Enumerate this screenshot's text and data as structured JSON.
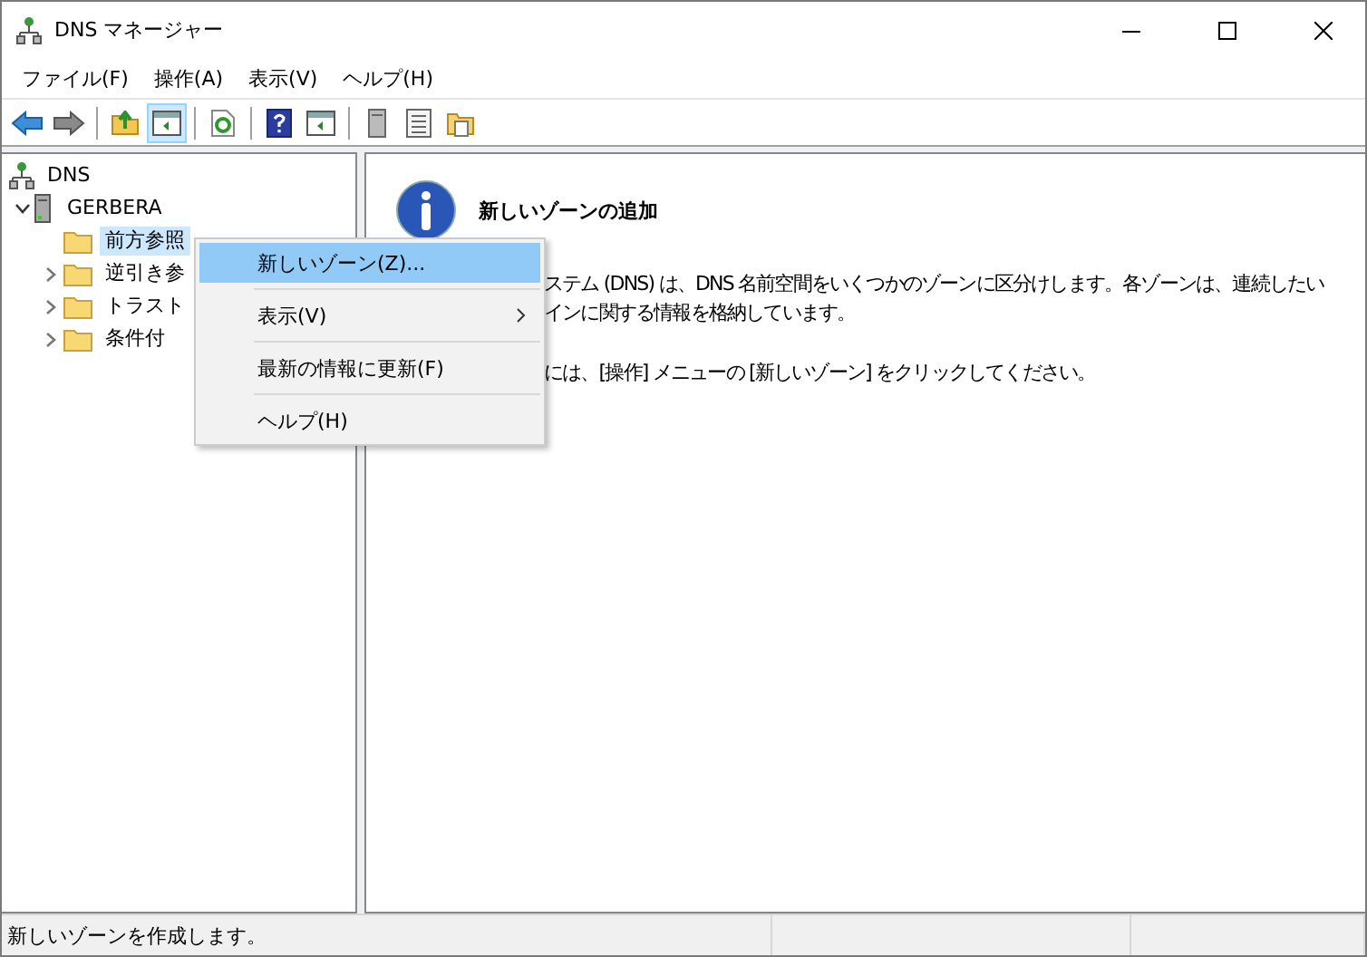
{
  "window": {
    "title": "DNS マネージャー"
  },
  "menu": [
    {
      "label": "ファイル(F)"
    },
    {
      "label": "操作(A)"
    },
    {
      "label": "表示(V)"
    },
    {
      "label": "ヘルプ(H)"
    }
  ],
  "toolbar": [
    {
      "kind": "back",
      "pressed": false
    },
    {
      "kind": "forward",
      "pressed": false
    },
    {
      "kind": "sep"
    },
    {
      "kind": "up",
      "pressed": false
    },
    {
      "kind": "tree",
      "pressed": true
    },
    {
      "kind": "sep"
    },
    {
      "kind": "refresh",
      "pressed": false
    },
    {
      "kind": "sep"
    },
    {
      "kind": "help",
      "pressed": false
    },
    {
      "kind": "pane",
      "pressed": false
    },
    {
      "kind": "sep"
    },
    {
      "kind": "server",
      "pressed": false
    },
    {
      "kind": "list",
      "pressed": false
    },
    {
      "kind": "props",
      "pressed": false
    }
  ],
  "tree": [
    {
      "label": "DNS",
      "kind": "dns",
      "selected": false,
      "children": [
        {
          "label": "GERBERA",
          "kind": "server",
          "expanded": true,
          "selected": false,
          "children": [
            {
              "label": "前方参照",
              "kind": "folder",
              "has_children": false,
              "selected": true
            },
            {
              "label": "逆引き参",
              "kind": "folder",
              "has_children": true,
              "selected": false
            },
            {
              "label": "トラスト",
              "kind": "folder",
              "has_children": true,
              "selected": false
            },
            {
              "label": "条件付",
              "kind": "folder",
              "has_children": true,
              "selected": false
            }
          ]
        }
      ]
    }
  ],
  "details": {
    "title": "新しいゾーンの追加",
    "paragraphs": [
      [
        "ステム (DNS) は、DNS 名前空間をいくつかのゾーンに区分けします。各ゾーンは、連続したい",
        "インに関する情報を格納しています。"
      ],
      [
        "には、[操作] メニューの [新しいゾーン] をクリックしてください。"
      ]
    ]
  },
  "context_menu": [
    {
      "label": "新しいゾーン(Z)...",
      "selected": true,
      "submenu": false
    },
    {
      "label": "表示(V)",
      "selected": false,
      "submenu": true
    },
    {
      "label": "最新の情報に更新(F)",
      "selected": false,
      "submenu": false
    },
    {
      "label": "ヘルプ(H)",
      "selected": false,
      "submenu": false
    }
  ],
  "status_bar": {
    "text": "新しいゾーンを作成します。"
  }
}
